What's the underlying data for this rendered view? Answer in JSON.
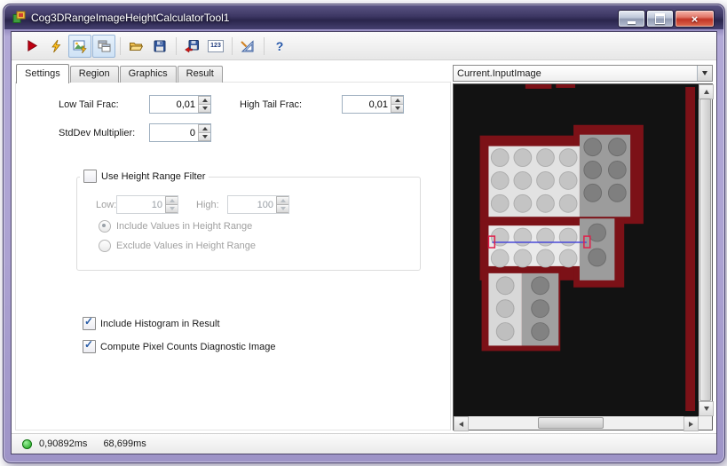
{
  "window": {
    "title": "Cog3DRangeImageHeightCalculatorTool1"
  },
  "toolbar": {
    "items": [
      {
        "name": "run-button",
        "icon": "play-icon"
      },
      {
        "name": "electric-run-button",
        "icon": "lightning-icon"
      },
      {
        "name": "auto-electric-run-toggle",
        "icon": "image-lightning-icon",
        "toggled": true
      },
      {
        "name": "float-results-toggle",
        "icon": "overlapping-windows-icon",
        "toggled": true
      },
      {
        "name": "open-button",
        "icon": "open-folder-icon"
      },
      {
        "name": "save-button",
        "icon": "floppy-disk-icon"
      },
      {
        "name": "export-image-button",
        "icon": "floppy-red-arrow-icon"
      },
      {
        "name": "constants-button",
        "icon": "numbers-123-icon",
        "text": "123"
      },
      {
        "name": "plot-button",
        "icon": "drafting-triangle-icon"
      },
      {
        "name": "help-button",
        "icon": "question-mark-icon",
        "text": "?"
      }
    ]
  },
  "tabs": [
    {
      "label": "Settings",
      "active": true
    },
    {
      "label": "Region",
      "active": false
    },
    {
      "label": "Graphics",
      "active": false
    },
    {
      "label": "Result",
      "active": false
    }
  ],
  "settings": {
    "low_tail_frac": {
      "label": "Low Tail Frac:",
      "value": "0,01"
    },
    "high_tail_frac": {
      "label": "High Tail Frac:",
      "value": "0,01"
    },
    "stddev_multiplier": {
      "label": "StdDev Multiplier:",
      "value": "0"
    },
    "height_range_filter": {
      "checkbox_label": "Use Height Range Filter",
      "checked": false,
      "low": {
        "label": "Low:",
        "value": "10"
      },
      "high": {
        "label": "High:",
        "value": "100"
      },
      "include_option": "Include Values in Height Range",
      "exclude_option": "Exclude Values in Height Range",
      "selected_option": "include"
    },
    "include_histogram": {
      "label": "Include Histogram in Result",
      "checked": true
    },
    "compute_pixel_counts": {
      "label": "Compute Pixel Counts Diagnostic Image",
      "checked": true
    }
  },
  "image_panel": {
    "selected_image": "Current.InputImage",
    "colors": {
      "background": "#121212",
      "exposed_surface": "#7c1117",
      "plate_light": "#e2e2e2",
      "plate_gray": "#9c9c9c",
      "region_line": "#4949d8",
      "region_handles": "#e0204a"
    }
  },
  "status_bar": {
    "run_time": "0,90892ms",
    "total_time": "68,699ms"
  }
}
